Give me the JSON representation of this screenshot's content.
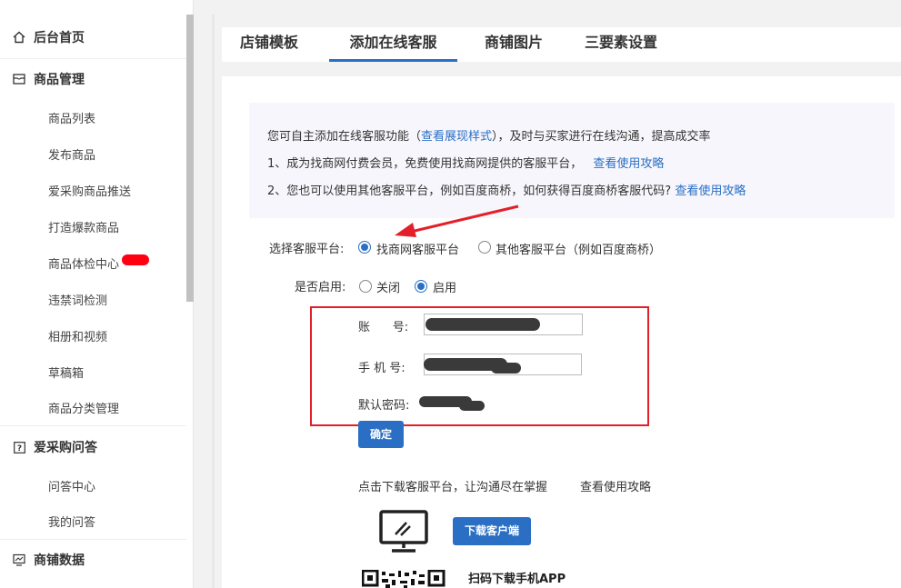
{
  "sidebar": {
    "home": "后台首页",
    "goods": {
      "title": "商品管理",
      "items": [
        "商品列表",
        "发布商品",
        "爱采购商品推送",
        "打造爆款商品",
        "商品体检中心",
        "违禁词检测",
        "相册和视频",
        "草稿箱",
        "商品分类管理"
      ]
    },
    "qa": {
      "title": "爱采购问答",
      "items": [
        "问答中心",
        "我的问答"
      ]
    },
    "shop_data": "商铺数据"
  },
  "tabs": [
    "店铺模板",
    "添加在线客服",
    "商铺图片",
    "三要素设置"
  ],
  "active_tab": 1,
  "info": {
    "line1_a": "您可自主添加在线客服功能（",
    "line1_link": "查看展现样式",
    "line1_b": "），及时与买家进行在线沟通，提高成交率",
    "line2": "1、成为找商网付费会员，免费使用找商网提供的客服平台，",
    "line2_link": "查看使用攻略",
    "line3": "2、您也可以使用其他客服平台，例如百度商桥，如何获得百度商桥客服代码?",
    "line3_link": "查看使用攻略"
  },
  "form": {
    "platform_label": "选择客服平台:",
    "platform_opt1": "找商网客服平台",
    "platform_opt2": "其他客服平台（例如百度商桥）",
    "enable_label": "是否启用:",
    "enable_off": "关闭",
    "enable_on": "启用",
    "account_label": "账      号:",
    "phone_label": "手 机 号:",
    "password_label": "默认密码:",
    "confirm": "确定"
  },
  "download": {
    "text": "点击下载客服平台，让沟通尽在掌握",
    "link": "查看使用攻略",
    "client_btn": "下载客户端",
    "app_text": "扫码下载手机APP"
  },
  "colors": {
    "accent": "#2a6fc4",
    "annotation": "#e3202a"
  }
}
